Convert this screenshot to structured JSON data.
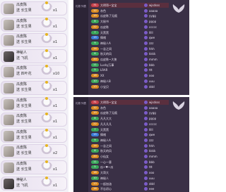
{
  "chat": {
    "rows": [
      {
        "name": "瓜皮陈",
        "sub": "送 长生果",
        "count": "x1",
        "dark": false
      },
      {
        "name": "瓜皮陈",
        "sub": "送 长生果",
        "count": "x1",
        "dark": false
      },
      {
        "name": "瓜皮陈",
        "sub": "送 长生果",
        "count": "x1",
        "dark": false
      },
      {
        "name": "神秘人",
        "sub": "送 飞机",
        "count": "x1",
        "dark": true
      },
      {
        "name": "瓜皮陈",
        "sub": "送 四叶花",
        "count": "x10",
        "dark": false
      },
      {
        "name": "瓜皮陈",
        "sub": "送 长生果",
        "count": "x1",
        "dark": false
      },
      {
        "name": "瓜皮陈",
        "sub": "送 长生果",
        "count": "x1",
        "dark": false
      },
      {
        "name": "瓜皮陈",
        "sub": "送 长生果",
        "count": "x1",
        "dark": false
      },
      {
        "name": "瓜皮陈",
        "sub": "送 长生果",
        "count": "x1",
        "dark": false
      },
      {
        "name": "瓜皮陈",
        "sub": "送 长生果",
        "count": "x2",
        "dark": false
      },
      {
        "name": "瓜皮陈",
        "sub": "送 长生果",
        "count": "x1",
        "dark": false
      },
      {
        "name": "神秘人",
        "sub": "送 飞机",
        "count": "x1",
        "dark": true
      }
    ]
  },
  "log_top": {
    "side_label": "礼物 列表",
    "rows": [
      {
        "lvl": "31",
        "color": "r",
        "user": "大明哥~宝宝",
        "gift": "wjsdsss",
        "hl": true
      },
      {
        "lvl": "12",
        "color": "o",
        "user": "灰色",
        "gift": "aaaaa",
        "hl": false
      },
      {
        "lvl": "19",
        "color": "o",
        "user": "瓜皮陈了无痕",
        "gift": "yygg",
        "hl": false
      },
      {
        "lvl": "8",
        "color": "g",
        "user": "大秘书",
        "gift": "pppp",
        "hl": false
      },
      {
        "lvl": "22",
        "color": "o",
        "user": "瓜皮陈",
        "gift": "ccccc",
        "hl": false
      },
      {
        "lvl": "7",
        "color": "g",
        "user": "天黑黑",
        "gift": "lllll",
        "hl": false
      },
      {
        "lvl": "15",
        "color": "b",
        "user": "情绪",
        "gift": "qwe",
        "hl": false
      },
      {
        "lvl": "9",
        "color": "g",
        "user": "神秘人A",
        "gift": "zzz",
        "hl": false
      },
      {
        "lvl": "14",
        "color": "o",
        "user": "一念之间",
        "gift": "hhh",
        "hl": false
      },
      {
        "lvl": "6",
        "color": "g",
        "user": "秋天的风",
        "gift": "kkkk",
        "hl": false
      },
      {
        "lvl": "20",
        "color": "o",
        "user": "瓜皮陈~大侠",
        "gift": "mmm",
        "hl": false
      },
      {
        "lvl": "11",
        "color": "g",
        "user": "Lucky万事",
        "gift": "bbb",
        "hl": false
      },
      {
        "lvl": "5",
        "color": "g",
        "user": "LRAR",
        "gift": "ttt",
        "hl": false
      },
      {
        "lvl": "18",
        "color": "o",
        "user": "XX",
        "gift": "ooo",
        "hl": false
      },
      {
        "lvl": "10",
        "color": "g",
        "user": "神秘人B",
        "gift": "uuu",
        "hl": false
      },
      {
        "lvl": "13",
        "color": "o",
        "user": "小宝贝",
        "gift": "ddd",
        "hl": false
      }
    ]
  },
  "log_bottom": {
    "side_label": "礼物 列表",
    "rows": [
      {
        "lvl": "31",
        "color": "r",
        "user": "大明哥~宝宝",
        "gift": "wjsdsss",
        "hl": true
      },
      {
        "lvl": "12",
        "color": "o",
        "user": "灰色",
        "gift": "aaaaa",
        "hl": false
      },
      {
        "lvl": "19",
        "color": "o",
        "user": "瓜皮陈了无痕",
        "gift": "yygg",
        "hl": false
      },
      {
        "lvl": "8",
        "color": "g",
        "user": "凡凡大大",
        "gift": "pppp",
        "hl": false
      },
      {
        "lvl": "22",
        "color": "o",
        "user": "凡凡凡凡",
        "gift": "ccccc",
        "hl": false
      },
      {
        "lvl": "7",
        "color": "g",
        "user": "天黑黑",
        "gift": "lllll",
        "hl": false
      },
      {
        "lvl": "15",
        "color": "b",
        "user": "情绪",
        "gift": "qwe",
        "hl": false
      },
      {
        "lvl": "9",
        "color": "g",
        "user": "神秘人A",
        "gift": "zzz",
        "hl": false
      },
      {
        "lvl": "14",
        "color": "o",
        "user": "一念之间",
        "gift": "hhh",
        "hl": false
      },
      {
        "lvl": "6",
        "color": "g",
        "user": "秋天的风",
        "gift": "kkkk",
        "hl": false
      },
      {
        "lvl": "20",
        "color": "o",
        "user": "小仙女",
        "gift": "mmm",
        "hl": false
      },
      {
        "lvl": "11",
        "color": "g",
        "user": "一心一意",
        "gift": "bbb",
        "hl": false
      },
      {
        "lvl": "5",
        "color": "g",
        "user": "瓜~♥~瓜",
        "gift": "ttt",
        "hl": false
      },
      {
        "lvl": "18",
        "color": "o",
        "user": "大哥大",
        "gift": "ooo",
        "hl": false
      },
      {
        "lvl": "10",
        "color": "g",
        "user": "神秘人",
        "gift": "uuu",
        "hl": false
      },
      {
        "lvl": "13",
        "color": "o",
        "user": "一起加油",
        "gift": "ddd",
        "hl": false
      },
      {
        "lvl": "16",
        "color": "o",
        "user": "不忘初心",
        "gift": "eee",
        "hl": false
      }
    ]
  }
}
